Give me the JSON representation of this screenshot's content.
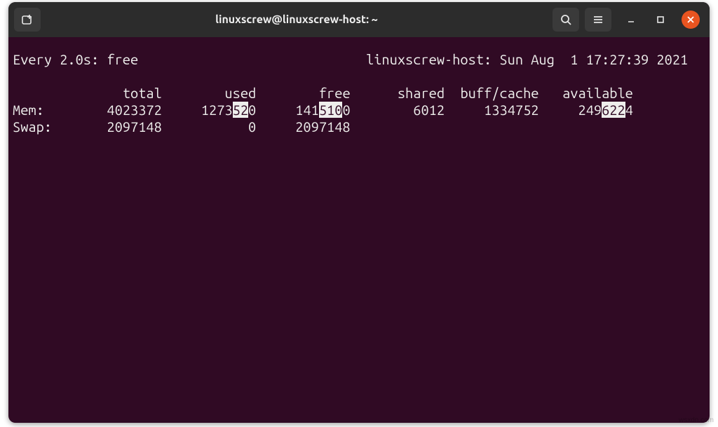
{
  "window": {
    "title": "linuxscrew@linuxscrew-host: ~"
  },
  "watch": {
    "interval_label": "Every 2.0s:",
    "command": "free",
    "hostinfo": "linuxscrew-host: Sun Aug  1 17:27:39 2021"
  },
  "headers": {
    "c1": "total",
    "c2": "used",
    "c3": "free",
    "c4": "shared",
    "c5": "buff/cache",
    "c6": "available"
  },
  "mem": {
    "label": "Mem:",
    "total": "4023372",
    "used_pre": "1273",
    "used_hl": "52",
    "used_post": "0",
    "free_pre": "141",
    "free_hl": "510",
    "free_post": "0",
    "shared": "6012",
    "buffcache": "1334752",
    "avail_pre": "249",
    "avail_hl": "622",
    "avail_post": "4"
  },
  "swap": {
    "label": "Swap:",
    "total": "2097148",
    "used": "0",
    "free": "2097148"
  },
  "watermark": "wsxdn.com"
}
